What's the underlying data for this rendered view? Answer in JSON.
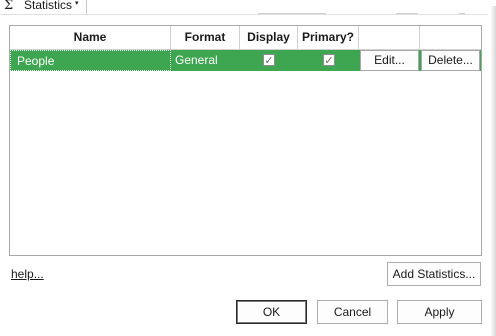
{
  "window": {
    "sigma_symbol": "Σ",
    "tab_label": "Statistics",
    "tab_caret": "▾"
  },
  "table": {
    "columns": [
      "Name",
      "Format",
      "Display",
      "Primary?",
      "",
      ""
    ],
    "rows": [
      {
        "name": "People",
        "format": "General",
        "display": true,
        "primary": true,
        "edit_label": "Edit...",
        "delete_label": "Delete..."
      }
    ],
    "selected_row_color": "#3ea650"
  },
  "footer": {
    "help_link": "help...",
    "add_button": "Add Statistics...",
    "ok_button": "OK",
    "cancel_button": "Cancel",
    "apply_button": "Apply"
  },
  "icons": {
    "check": "✓"
  }
}
